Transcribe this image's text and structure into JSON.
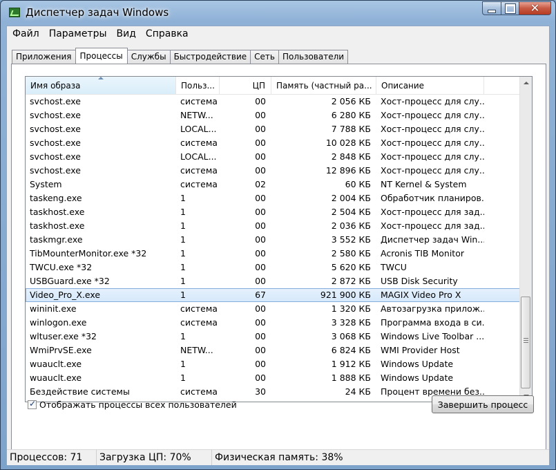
{
  "window": {
    "title": "Диспетчер задач Windows"
  },
  "menu": [
    "Файл",
    "Параметры",
    "Вид",
    "Справка"
  ],
  "tabs": [
    "Приложения",
    "Процессы",
    "Службы",
    "Быстродействие",
    "Сеть",
    "Пользователи"
  ],
  "active_tab": "Процессы",
  "columns": [
    "Имя образа",
    "Польз...",
    "ЦП",
    "Память (частный ра...",
    "Описание"
  ],
  "sorted_column": "Имя образа",
  "rows": [
    {
      "name": "svchost.exe",
      "user": "система",
      "cpu": "00",
      "mem": "2 056 КБ",
      "desc": "Хост-процесс для слу..."
    },
    {
      "name": "svchost.exe",
      "user": "NETW...",
      "cpu": "00",
      "mem": "6 280 КБ",
      "desc": "Хост-процесс для слу..."
    },
    {
      "name": "svchost.exe",
      "user": "LOCAL...",
      "cpu": "00",
      "mem": "7 788 КБ",
      "desc": "Хост-процесс для слу..."
    },
    {
      "name": "svchost.exe",
      "user": "система",
      "cpu": "00",
      "mem": "10 028 КБ",
      "desc": "Хост-процесс для слу..."
    },
    {
      "name": "svchost.exe",
      "user": "LOCAL...",
      "cpu": "00",
      "mem": "2 848 КБ",
      "desc": "Хост-процесс для слу..."
    },
    {
      "name": "svchost.exe",
      "user": "система",
      "cpu": "00",
      "mem": "12 896 КБ",
      "desc": "Хост-процесс для слу..."
    },
    {
      "name": "System",
      "user": "система",
      "cpu": "02",
      "mem": "60 КБ",
      "desc": "NT Kernel & System"
    },
    {
      "name": "taskeng.exe",
      "user": "1",
      "cpu": "00",
      "mem": "2 004 КБ",
      "desc": "Обработчик планиров..."
    },
    {
      "name": "taskhost.exe",
      "user": "1",
      "cpu": "00",
      "mem": "2 504 КБ",
      "desc": "Хост-процесс для зад..."
    },
    {
      "name": "taskhost.exe",
      "user": "1",
      "cpu": "00",
      "mem": "2 036 КБ",
      "desc": "Хост-процесс для зад..."
    },
    {
      "name": "taskmgr.exe",
      "user": "1",
      "cpu": "00",
      "mem": "3 552 КБ",
      "desc": "Диспетчер задач Win..."
    },
    {
      "name": "TibMounterMonitor.exe *32",
      "user": "1",
      "cpu": "00",
      "mem": "2 580 КБ",
      "desc": "Acronis TIB Monitor"
    },
    {
      "name": "TWCU.exe *32",
      "user": "1",
      "cpu": "00",
      "mem": "5 620 КБ",
      "desc": "TWCU"
    },
    {
      "name": "USBGuard.exe *32",
      "user": "1",
      "cpu": "00",
      "mem": "2 872 КБ",
      "desc": "USB Disk Security"
    },
    {
      "name": "Video_Pro_X.exe",
      "user": "1",
      "cpu": "67",
      "mem": "921 900 КБ",
      "desc": "MAGIX Video Pro X",
      "selected": true
    },
    {
      "name": "wininit.exe",
      "user": "система",
      "cpu": "00",
      "mem": "1 320 КБ",
      "desc": "Автозагрузка прилож..."
    },
    {
      "name": "winlogon.exe",
      "user": "система",
      "cpu": "00",
      "mem": "3 328 КБ",
      "desc": "Программа входа в си..."
    },
    {
      "name": "wltuser.exe *32",
      "user": "1",
      "cpu": "00",
      "mem": "3 068 КБ",
      "desc": "Windows Live Toolbar ..."
    },
    {
      "name": "WmiPrvSE.exe",
      "user": "NETW...",
      "cpu": "00",
      "mem": "6 824 КБ",
      "desc": "WMI Provider Host"
    },
    {
      "name": "wuauclt.exe",
      "user": "1",
      "cpu": "00",
      "mem": "1 912 КБ",
      "desc": "Windows Update"
    },
    {
      "name": "wuauclt.exe",
      "user": "1",
      "cpu": "00",
      "mem": "1 888 КБ",
      "desc": "Windows Update"
    },
    {
      "name": "Бездействие системы",
      "user": "система",
      "cpu": "30",
      "mem": "24 КБ",
      "desc": "Процент времени без..."
    }
  ],
  "show_all_users": {
    "label": "Отображать процессы всех пользователей",
    "checked": true
  },
  "end_process_label": "Завершить процесс",
  "status": {
    "processes": "Процессов: 71",
    "cpu": "Загрузка ЦП: 70%",
    "memory": "Физическая память: 38%"
  },
  "icons": [
    "app-icon",
    "minimize-icon",
    "maximize-icon",
    "close-icon",
    "sort-ascending-icon",
    "scroll-up-icon",
    "scroll-down-icon",
    "check-icon"
  ]
}
